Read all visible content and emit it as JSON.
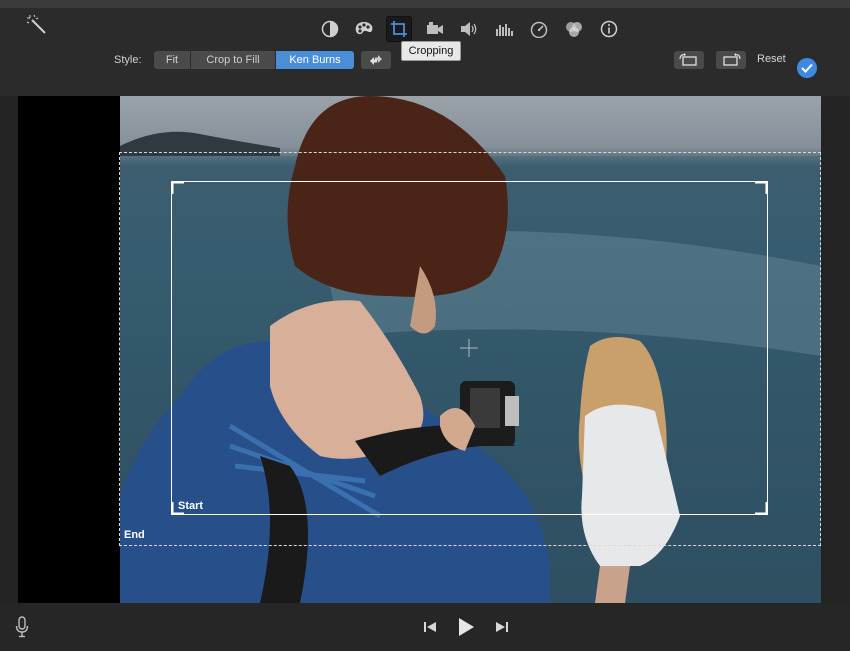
{
  "toolbar": {
    "tools": [
      "magic-wand",
      "color-balance",
      "color-correction",
      "cropping",
      "stabilization",
      "volume",
      "noise-reduction",
      "speed",
      "filters",
      "info"
    ],
    "active_tool": "cropping",
    "tooltip": "Cropping",
    "style_label": "Style:",
    "styles": [
      "Fit",
      "Crop to Fill",
      "Ken Burns"
    ],
    "selected_style": "Ken Burns",
    "reset_label": "Reset"
  },
  "viewer": {
    "start_label": "Start",
    "end_label": "End"
  },
  "colors": {
    "accent": "#4b8ed8",
    "background": "#232323",
    "toolbar": "#2b2b2b"
  }
}
